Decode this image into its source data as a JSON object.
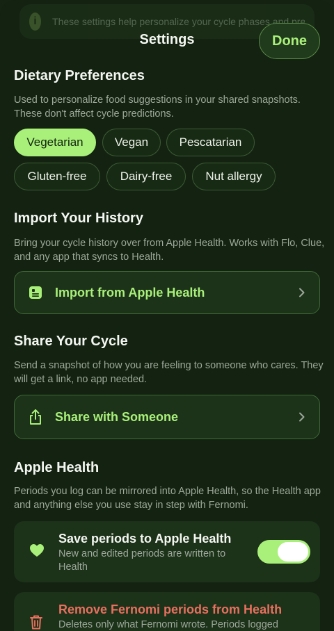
{
  "banner": {
    "text": "These settings help personalize your cycle phases and predict accurately your phase day"
  },
  "header": {
    "title": "Settings",
    "done_label": "Done"
  },
  "dietary": {
    "title": "Dietary Preferences",
    "description": "Used to personalize food suggestions in your shared snapshots. These don't affect cycle predictions.",
    "chips": [
      {
        "label": "Vegetarian",
        "selected": true
      },
      {
        "label": "Vegan",
        "selected": false
      },
      {
        "label": "Pescatarian",
        "selected": false
      },
      {
        "label": "Gluten-free",
        "selected": false
      },
      {
        "label": "Dairy-free",
        "selected": false
      },
      {
        "label": "Nut allergy",
        "selected": false
      }
    ]
  },
  "import": {
    "title": "Import Your History",
    "description": "Bring your cycle history over from Apple Health. Works with Flo, Clue, and any app that syncs to Health.",
    "button_label": "Import from Apple Health",
    "icon": "health-record-icon"
  },
  "share": {
    "title": "Share Your Cycle",
    "description": "Send a snapshot of how you are feeling to someone who cares. They will get a link, no app needed.",
    "button_label": "Share with Someone",
    "icon": "share-icon"
  },
  "apple_health": {
    "title": "Apple Health",
    "description": "Periods you log can be mirrored into Apple Health, so the Health app and anything else you use stay in step with Fernomi.",
    "save_title": "Save periods to Apple Health",
    "save_subtitle": "New and edited periods are written to Health",
    "save_enabled": true,
    "remove_title": "Remove Fernomi periods from Health",
    "remove_subtitle": "Deletes only what Fernomi wrote. Periods logged"
  },
  "colors": {
    "accent": "#a9f07a",
    "background": "#132211",
    "card": "#1c3219",
    "danger": "#e8705f"
  }
}
